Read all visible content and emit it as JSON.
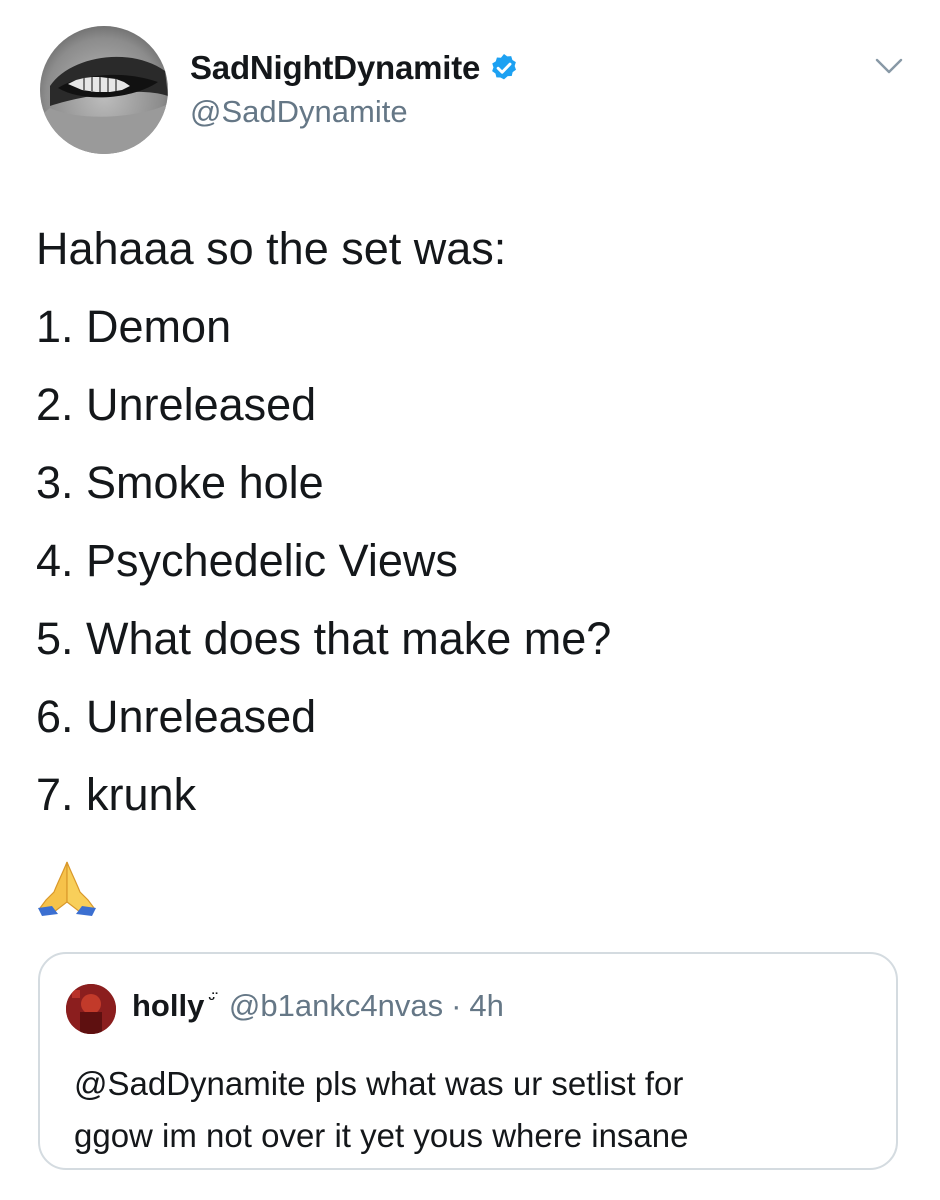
{
  "tweet": {
    "author": {
      "display_name": "SadNightDynamite",
      "handle": "@SadDynamite",
      "verified_icon": "verified-badge-icon",
      "avatar_icon": "profile-avatar"
    },
    "menu_icon": "chevron-down-icon",
    "text_lines": [
      "Hahaaa so the set was:",
      "1. Demon",
      "2. Unreleased",
      "3. Smoke hole",
      "4. Psychedelic Views",
      "5. What does that make me?",
      "6. Unreleased",
      "7. krunk"
    ],
    "emoji_icon": "folded-hands-emoji"
  },
  "quoted_tweet": {
    "display_name": "holly",
    "name_symbol": "ᵕ̈",
    "handle": "@b1ankc4nvas",
    "separator": "·",
    "time": "4h",
    "text_lines": [
      "@SadDynamite pls what was ur setlist for",
      "ggow im not over it yet yous where insane"
    ]
  },
  "colors": {
    "text_primary": "#14171a",
    "text_secondary": "#657786",
    "verified_blue": "#1da1f2",
    "border": "#d4dbe0"
  }
}
